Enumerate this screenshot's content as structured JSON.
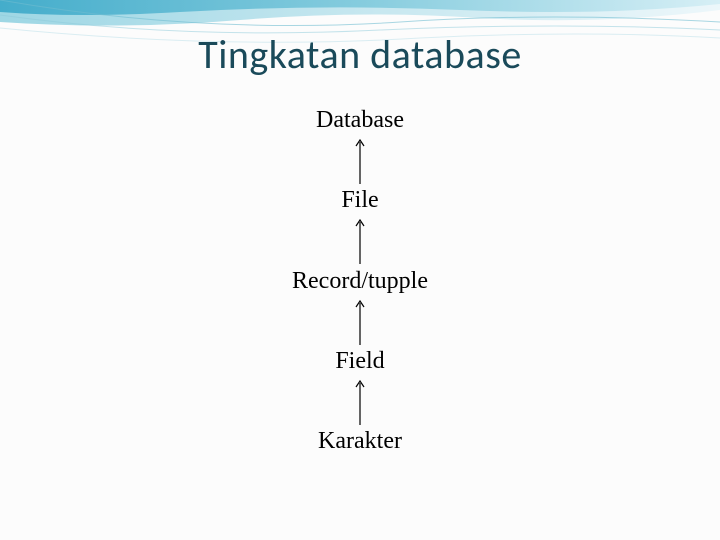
{
  "title": "Tingkatan database",
  "levels": {
    "l1": "Database",
    "l2": "File",
    "l3": "Record/tupple",
    "l4": "Field",
    "l5": "Karakter"
  }
}
